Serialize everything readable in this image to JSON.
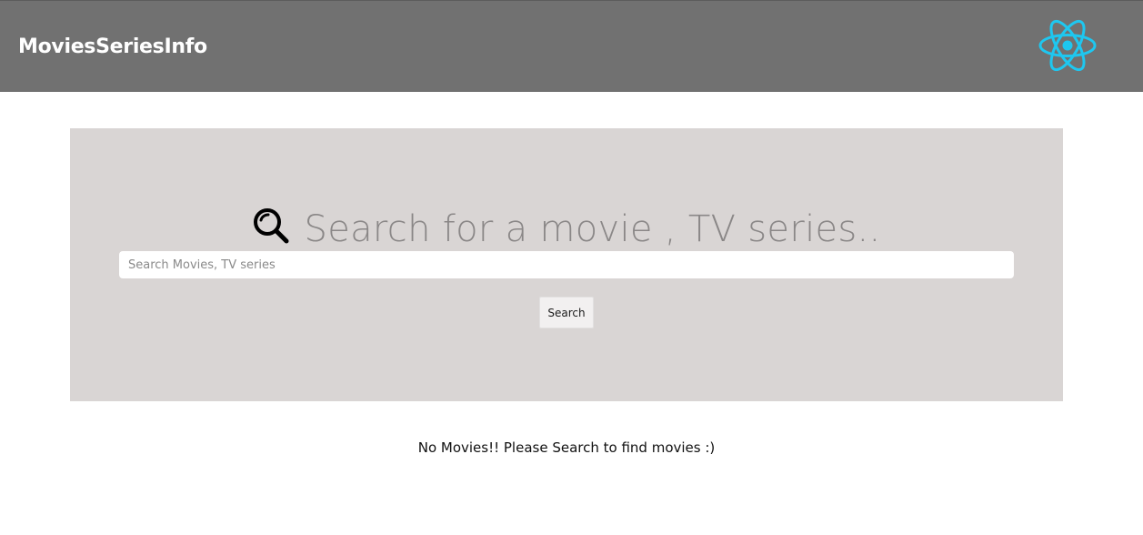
{
  "navbar": {
    "brand": "MoviesSeriesInfo",
    "logo_icon": "react-logo-icon",
    "background_color": "#717171",
    "logo_color": "#1ec7f0"
  },
  "hero": {
    "heading": "Search for a movie , TV series..",
    "heading_icon": "search-icon",
    "background_color": "#d9d5d4",
    "search": {
      "placeholder": "Search Movies, TV series",
      "value": ""
    },
    "search_button_label": "Search"
  },
  "results": {
    "empty_message": "No Movies!! Please Search to find movies :)"
  }
}
